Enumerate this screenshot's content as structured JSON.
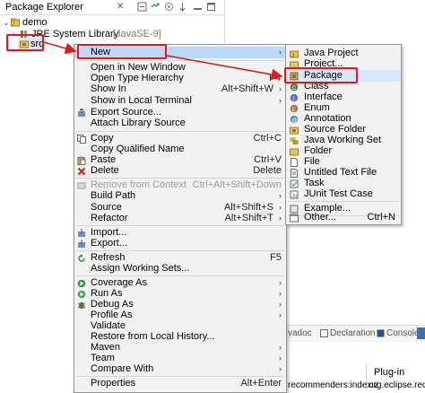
{
  "package_explorer": {
    "title": "Package Explorer",
    "tree": {
      "project": "demo",
      "library": "JRE System Library",
      "library_tag": "[JavaSE-9]",
      "src": "src"
    }
  },
  "context_menu": {
    "items": [
      {
        "label": "New",
        "arrow": "›"
      },
      {
        "label": "Open in New Window"
      },
      {
        "label": "Open Type Hierarchy",
        "shortcut": "F4"
      },
      {
        "label": "Show In",
        "shortcut": "Alt+Shift+W",
        "arrow": "›"
      },
      {
        "label": "Show in Local Terminal",
        "arrow": "›"
      },
      {
        "label": "Export Source..."
      },
      {
        "label": "Attach Library Source"
      },
      {
        "label": "Copy",
        "shortcut": "Ctrl+C"
      },
      {
        "label": "Copy Qualified Name"
      },
      {
        "label": "Paste",
        "shortcut": "Ctrl+V"
      },
      {
        "label": "Delete",
        "shortcut": "Delete"
      },
      {
        "label": "Remove from Context",
        "shortcut": "Ctrl+Alt+Shift+Down"
      },
      {
        "label": "Build Path",
        "arrow": "›"
      },
      {
        "label": "Source",
        "shortcut": "Alt+Shift+S",
        "arrow": "›"
      },
      {
        "label": "Refactor",
        "shortcut": "Alt+Shift+T",
        "arrow": "›"
      },
      {
        "label": "Import..."
      },
      {
        "label": "Export..."
      },
      {
        "label": "Refresh",
        "shortcut": "F5"
      },
      {
        "label": "Assign Working Sets..."
      },
      {
        "label": "Coverage As",
        "arrow": "›"
      },
      {
        "label": "Run As",
        "arrow": "›"
      },
      {
        "label": "Debug As",
        "arrow": "›"
      },
      {
        "label": "Profile As",
        "arrow": "›"
      },
      {
        "label": "Validate"
      },
      {
        "label": "Restore from Local History..."
      },
      {
        "label": "Maven",
        "arrow": "›"
      },
      {
        "label": "Team",
        "arrow": "›"
      },
      {
        "label": "Compare With",
        "arrow": "›"
      },
      {
        "label": "Properties",
        "shortcut": "Alt+Enter"
      }
    ]
  },
  "submenu": {
    "items": [
      {
        "label": "Java Project"
      },
      {
        "label": "Project..."
      },
      {
        "label": "Package"
      },
      {
        "label": "Class"
      },
      {
        "label": "Interface"
      },
      {
        "label": "Enum"
      },
      {
        "label": "Annotation"
      },
      {
        "label": "Source Folder"
      },
      {
        "label": "Java Working Set"
      },
      {
        "label": "Folder"
      },
      {
        "label": "File"
      },
      {
        "label": "Untitled Text File"
      },
      {
        "label": "Task"
      },
      {
        "label": "JUnit Test Case"
      },
      {
        "label": "Example..."
      },
      {
        "label": "Other...",
        "shortcut": "Ctrl+N"
      }
    ]
  },
  "bottom_panel": {
    "tabs": [
      "vadoc",
      "Declaration",
      "Console"
    ],
    "column_header": "Plug-in",
    "row_left": "recommenders:index:z",
    "row_right": "org.eclipse.reco"
  },
  "colors": {
    "highlight_red": "#e0191b",
    "menu_hover": "#bcd9f7"
  }
}
